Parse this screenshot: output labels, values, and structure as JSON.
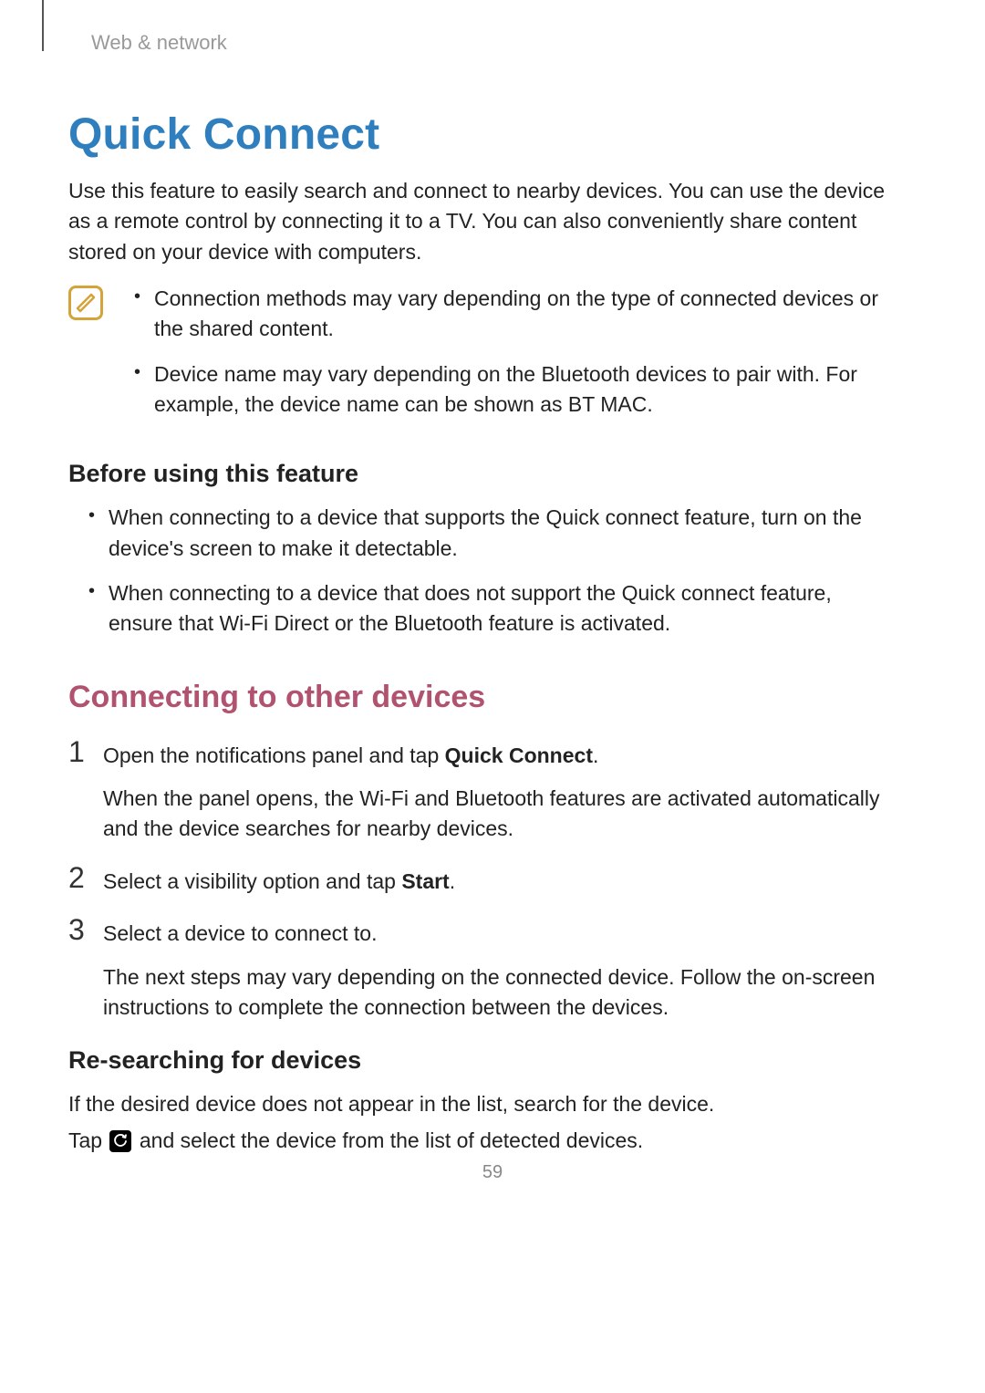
{
  "breadcrumb": "Web & network",
  "title": "Quick Connect",
  "intro": "Use this feature to easily search and connect to nearby devices. You can use the device as a remote control by connecting it to a TV. You can also conveniently share content stored on your device with computers.",
  "notes": {
    "items": [
      "Connection methods may vary depending on the type of connected devices or the shared content.",
      "Device name may vary depending on the Bluetooth devices to pair with. For example, the device name can be shown as BT MAC."
    ]
  },
  "before": {
    "heading": "Before using this feature",
    "items": [
      "When connecting to a device that supports the Quick connect feature, turn on the device's screen to make it detectable.",
      "When connecting to a device that does not support the Quick connect feature, ensure that Wi-Fi Direct or the Bluetooth feature is activated."
    ]
  },
  "connecting": {
    "heading": "Connecting to other devices",
    "steps": [
      {
        "num": "1",
        "text_pre": "Open the notifications panel and tap ",
        "text_bold": "Quick Connect",
        "text_post": ".",
        "follow": "When the panel opens, the Wi-Fi and Bluetooth features are activated automatically and the device searches for nearby devices."
      },
      {
        "num": "2",
        "text_pre": "Select a visibility option and tap ",
        "text_bold": "Start",
        "text_post": ".",
        "follow": ""
      },
      {
        "num": "3",
        "text_pre": "Select a device to connect to.",
        "text_bold": "",
        "text_post": "",
        "follow": "The next steps may vary depending on the connected device. Follow the on-screen instructions to complete the connection between the devices."
      }
    ]
  },
  "research": {
    "heading": "Re-searching for devices",
    "p1": "If the desired device does not appear in the list, search for the device.",
    "p2_pre": "Tap ",
    "p2_post": " and select the device from the list of detected devices."
  },
  "page_number": "59"
}
